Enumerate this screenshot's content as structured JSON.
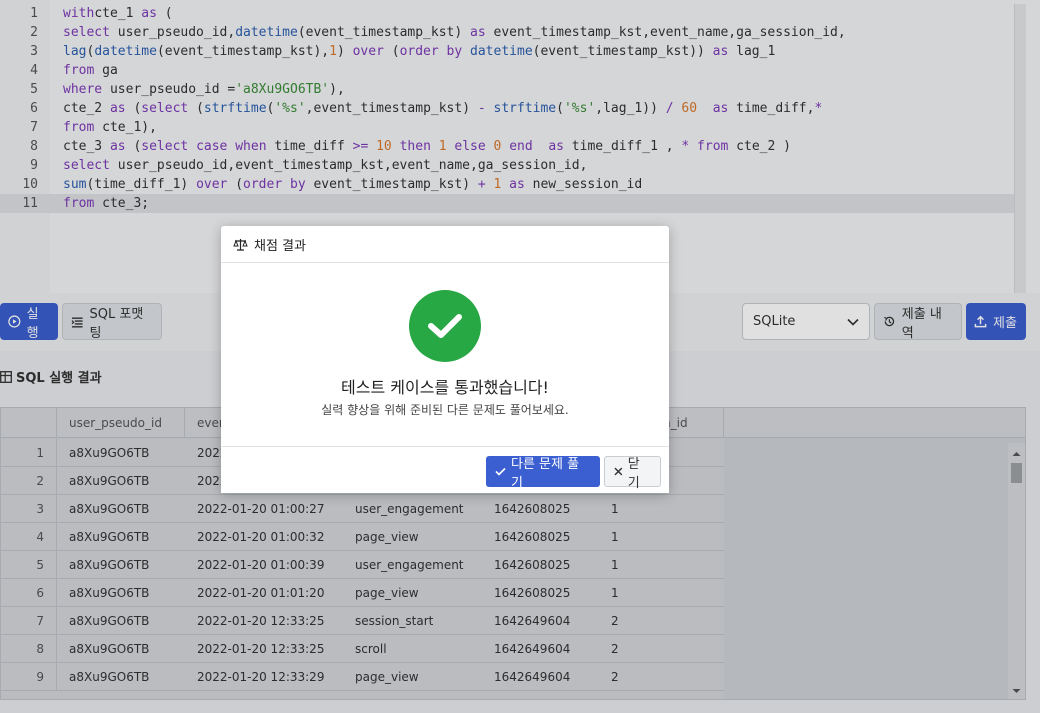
{
  "editor": {
    "lines": [
      {
        "no": "1",
        "segs": [
          [
            "k",
            "with"
          ],
          [
            "",
            "cte_1 "
          ],
          [
            "k",
            "as"
          ],
          [
            "",
            " ("
          ]
        ]
      },
      {
        "no": "2",
        "segs": [
          [
            "k",
            "select"
          ],
          [
            "",
            " user_pseudo_id,"
          ],
          [
            "f",
            "datetime"
          ],
          [
            "",
            "(event_timestamp_kst) "
          ],
          [
            "k",
            "as"
          ],
          [
            "",
            " event_timestamp_kst,event_name,ga_session_id,"
          ]
        ]
      },
      {
        "no": "3",
        "segs": [
          [
            "f",
            "lag"
          ],
          [
            "",
            "("
          ],
          [
            "f",
            "datetime"
          ],
          [
            "",
            "(event_timestamp_kst),"
          ],
          [
            "n",
            "1"
          ],
          [
            "",
            ") "
          ],
          [
            "k",
            "over"
          ],
          [
            "",
            " ("
          ],
          [
            "k",
            "order by"
          ],
          [
            "",
            " "
          ],
          [
            "f",
            "datetime"
          ],
          [
            "",
            "(event_timestamp_kst)) "
          ],
          [
            "k",
            "as"
          ],
          [
            "",
            " lag_1"
          ]
        ]
      },
      {
        "no": "4",
        "segs": [
          [
            "k",
            "from"
          ],
          [
            "",
            " ga"
          ]
        ]
      },
      {
        "no": "5",
        "segs": [
          [
            "k",
            "where"
          ],
          [
            "",
            " user_pseudo_id ="
          ],
          [
            "s",
            "'a8Xu9GO6TB'"
          ],
          [
            "",
            "),"
          ]
        ]
      },
      {
        "no": "6",
        "segs": [
          [
            "",
            "cte_2 "
          ],
          [
            "k",
            "as"
          ],
          [
            "",
            " ("
          ],
          [
            "k",
            "select"
          ],
          [
            "",
            " ("
          ],
          [
            "f",
            "strftime"
          ],
          [
            "",
            "("
          ],
          [
            "s",
            "'%s'"
          ],
          [
            "",
            ",event_timestamp_kst) "
          ],
          [
            "o",
            "-"
          ],
          [
            "",
            " "
          ],
          [
            "f",
            "strftime"
          ],
          [
            "",
            "("
          ],
          [
            "s",
            "'%s'"
          ],
          [
            "",
            ",lag_1)) "
          ],
          [
            "o",
            "/"
          ],
          [
            "",
            " "
          ],
          [
            "n",
            "60"
          ],
          [
            "",
            "  "
          ],
          [
            "k",
            "as"
          ],
          [
            "",
            " time_diff,"
          ],
          [
            "o",
            "*"
          ]
        ]
      },
      {
        "no": "7",
        "segs": [
          [
            "k",
            "from"
          ],
          [
            "",
            " cte_1),"
          ]
        ]
      },
      {
        "no": "8",
        "segs": [
          [
            "",
            "cte_3 "
          ],
          [
            "k",
            "as"
          ],
          [
            "",
            " ("
          ],
          [
            "k",
            "select"
          ],
          [
            "",
            " "
          ],
          [
            "k",
            "case"
          ],
          [
            "",
            " "
          ],
          [
            "k",
            "when"
          ],
          [
            "",
            " time_diff "
          ],
          [
            "o",
            ">="
          ],
          [
            "",
            " "
          ],
          [
            "n",
            "10"
          ],
          [
            "",
            " "
          ],
          [
            "k",
            "then"
          ],
          [
            "",
            " "
          ],
          [
            "n",
            "1"
          ],
          [
            "",
            " "
          ],
          [
            "k",
            "else"
          ],
          [
            "",
            " "
          ],
          [
            "n",
            "0"
          ],
          [
            "",
            " "
          ],
          [
            "k",
            "end"
          ],
          [
            "",
            "  "
          ],
          [
            "k",
            "as"
          ],
          [
            "",
            " time_diff_1 , "
          ],
          [
            "o",
            "*"
          ],
          [
            "",
            " "
          ],
          [
            "k",
            "from"
          ],
          [
            "",
            " cte_2 )"
          ]
        ]
      },
      {
        "no": "9",
        "segs": [
          [
            "k",
            "select"
          ],
          [
            "",
            " user_pseudo_id,event_timestamp_kst,event_name,ga_session_id,"
          ]
        ]
      },
      {
        "no": "10",
        "segs": [
          [
            "f",
            "sum"
          ],
          [
            "",
            "(time_diff_1) "
          ],
          [
            "k",
            "over"
          ],
          [
            "",
            " ("
          ],
          [
            "k",
            "order by"
          ],
          [
            "",
            " event_timestamp_kst) "
          ],
          [
            "o",
            "+"
          ],
          [
            "",
            " "
          ],
          [
            "n",
            "1"
          ],
          [
            "",
            " "
          ],
          [
            "k",
            "as"
          ],
          [
            "",
            " new_session_id"
          ]
        ]
      },
      {
        "no": "11",
        "segs": [
          [
            "k",
            "from"
          ],
          [
            "",
            " cte_3;"
          ]
        ]
      }
    ]
  },
  "toolbar": {
    "run_label": "실행",
    "format_label": "SQL 포맷팅",
    "dialect_value": "SQLite",
    "history_label": "제출 내역",
    "submit_label": "제출"
  },
  "results": {
    "title": "SQL 실행 결과",
    "columns": [
      "user_pseudo_id",
      "even",
      "",
      "",
      "n_id"
    ],
    "rows": [
      [
        "1",
        "a8Xu9GO6TB",
        "2022",
        "",
        "",
        ""
      ],
      [
        "2",
        "a8Xu9GO6TB",
        "2022",
        "",
        "",
        ""
      ],
      [
        "3",
        "a8Xu9GO6TB",
        "2022-01-20 01:00:27",
        "user_engagement",
        "1642608025",
        "1"
      ],
      [
        "4",
        "a8Xu9GO6TB",
        "2022-01-20 01:00:32",
        "page_view",
        "1642608025",
        "1"
      ],
      [
        "5",
        "a8Xu9GO6TB",
        "2022-01-20 01:00:39",
        "user_engagement",
        "1642608025",
        "1"
      ],
      [
        "6",
        "a8Xu9GO6TB",
        "2022-01-20 01:01:20",
        "page_view",
        "1642608025",
        "1"
      ],
      [
        "7",
        "a8Xu9GO6TB",
        "2022-01-20 12:33:25",
        "session_start",
        "1642649604",
        "2"
      ],
      [
        "8",
        "a8Xu9GO6TB",
        "2022-01-20 12:33:25",
        "scroll",
        "1642649604",
        "2"
      ],
      [
        "9",
        "a8Xu9GO6TB",
        "2022-01-20 12:33:29",
        "page_view",
        "1642649604",
        "2"
      ]
    ]
  },
  "modal": {
    "header": "채점 결과",
    "title": "테스트 케이스를 통과했습니다!",
    "subtitle": "실력 향상을 위해 준비된 다른 문제도 풀어보세요.",
    "next_label": "다른 문제 풀기",
    "close_label": "닫기"
  },
  "colors": {
    "primary": "#3b5fd1",
    "success": "#28a745"
  }
}
